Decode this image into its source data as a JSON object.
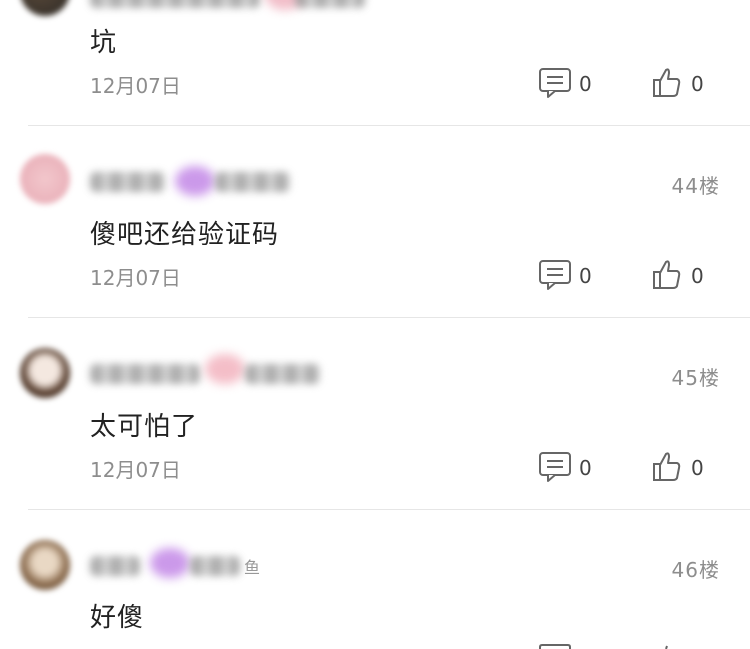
{
  "comments": [
    {
      "floor": "",
      "text": "坑",
      "date": "12月07日",
      "reply_count": "0",
      "like_count": "0"
    },
    {
      "floor": "44楼",
      "text": "傻吧还给验证码",
      "date": "12月07日",
      "reply_count": "0",
      "like_count": "0"
    },
    {
      "floor": "45楼",
      "text": "太可怕了",
      "date": "12月07日",
      "reply_count": "0",
      "like_count": "0"
    },
    {
      "floor": "46楼",
      "text": "好傻",
      "date": "",
      "reply_count": "",
      "like_count": ""
    }
  ],
  "partial_badge_char": "鱼",
  "icons": {
    "reply": "comment-bubble-icon",
    "like": "thumbs-up-icon"
  },
  "colors": {
    "meta": "#8d8d8d",
    "text": "#222222",
    "divider": "#e6e6e6"
  }
}
